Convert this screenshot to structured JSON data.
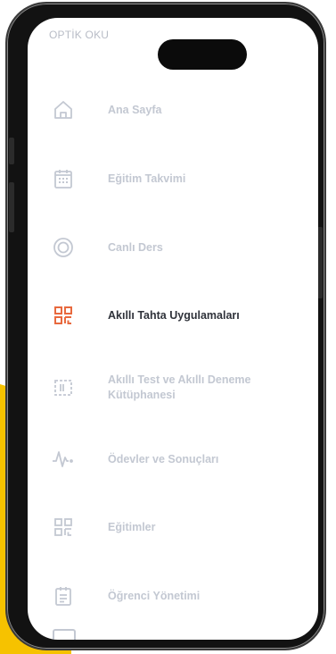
{
  "header": {
    "title": "OPTİK OKU"
  },
  "menu": {
    "items": [
      {
        "label": "Ana Sayfa",
        "icon": "home-icon",
        "active": false
      },
      {
        "label": "Eğitim Takvimi",
        "icon": "calendar-icon",
        "active": false
      },
      {
        "label": "Canlı Ders",
        "icon": "live-circle-icon",
        "active": false
      },
      {
        "label": "Akıllı Tahta Uygulamaları",
        "icon": "qr-grid-icon",
        "active": true
      },
      {
        "label": "Akıllı Test ve Akıllı Deneme Kütüphanesi",
        "icon": "library-icon",
        "active": false
      },
      {
        "label": "Ödevler ve Sonuçları",
        "icon": "pulse-icon",
        "active": false
      },
      {
        "label": "Eğitimler",
        "icon": "grid-icon",
        "active": false
      },
      {
        "label": "Öğrenci Yönetimi",
        "icon": "clipboard-icon",
        "active": false
      }
    ]
  },
  "colors": {
    "accent": "#e8693e",
    "inactive": "#c3c8d2",
    "active_text": "#2f323a",
    "yellow": "#f6c200",
    "phone_frame": "#121212"
  }
}
